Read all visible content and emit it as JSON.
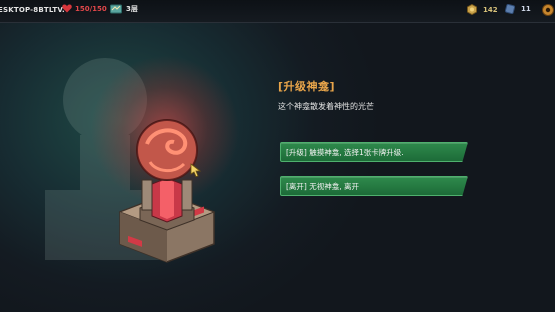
{
  "topbar": {
    "player_name": "ESKTOP-8BTLTV.",
    "hp": "150/150",
    "floor": "3层",
    "gold": "142",
    "gems": "11"
  },
  "event": {
    "title": "[升级神龛]",
    "description": "这个神龛散发着神性的光芒",
    "options": [
      {
        "label": "[升级] 触摸神龛, 选择1张卡牌升级."
      },
      {
        "label": "[离开] 无视神龛, 离开"
      }
    ]
  },
  "colors": {
    "title": "#e9a54a",
    "hp": "#e0474a",
    "option_green": "#2e8a4c"
  }
}
